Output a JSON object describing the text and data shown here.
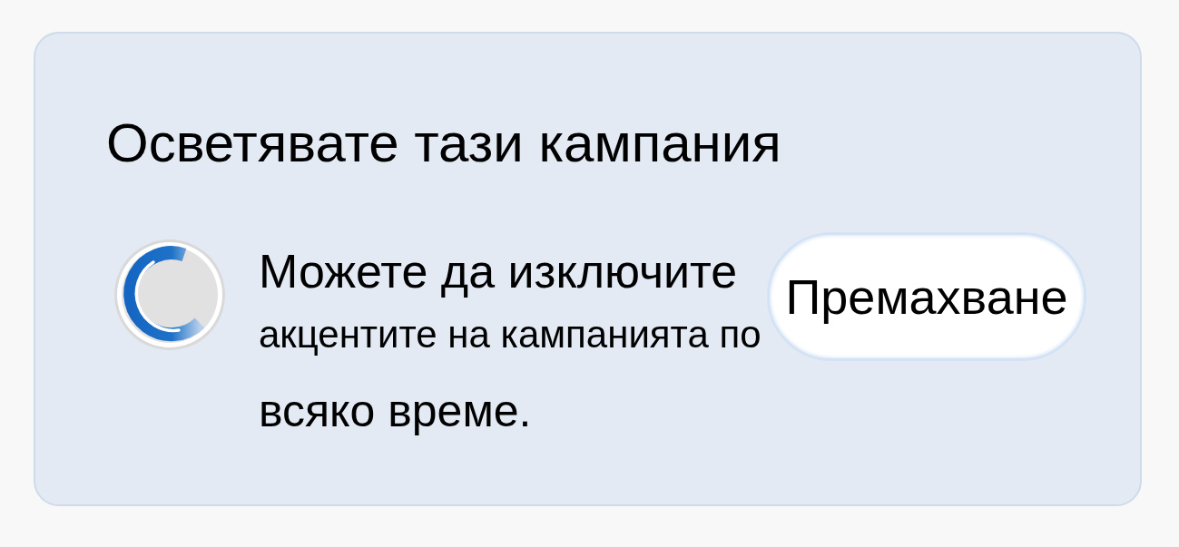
{
  "notice": {
    "title": "Осветявате тази кампания",
    "description_lines": [
      "Можете да изключите",
      "акцентите на кампанията по",
      "всяко време."
    ],
    "button": {
      "label": "Премахване"
    }
  }
}
